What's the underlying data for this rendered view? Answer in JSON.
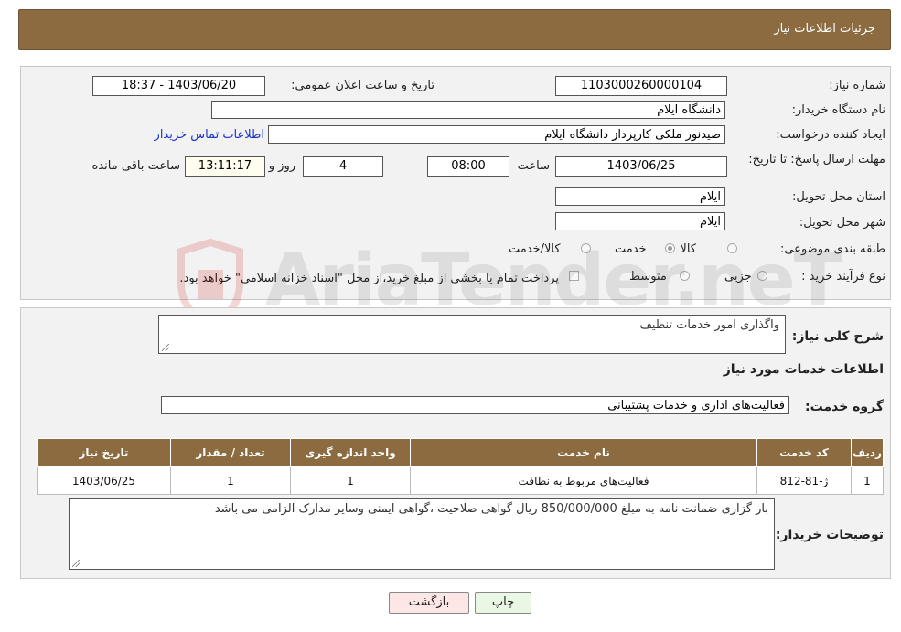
{
  "header": {
    "title": "جزئیات اطلاعات نیاز"
  },
  "form": {
    "need_number_label": "شماره نیاز:",
    "need_number": "1103000260000104",
    "announce_label": "تاریخ و ساعت اعلان عمومی:",
    "announce_value": "1403/06/20 - 18:37",
    "buyer_org_label": "نام دستگاه خریدار:",
    "buyer_org": "دانشگاه ایلام",
    "creator_label": "ایجاد کننده درخواست:",
    "creator": "صیدنور ملکی کارپرداز دانشگاه ایلام",
    "contact_link": "اطلاعات تماس خریدار",
    "deadline_label": "مهلت ارسال پاسخ: تا تاریخ:",
    "deadline_date": "1403/06/25",
    "time_label": "ساعت",
    "deadline_time": "08:00",
    "days_value": "4",
    "days_label": "روز و",
    "remaining_time": "13:11:17",
    "remaining_label": "ساعت باقی مانده",
    "province_label": "استان محل تحویل:",
    "province": "ایلام",
    "city_label": "شهر محل تحویل:",
    "city": "ایلام",
    "category_label": "طبقه بندی موضوعی:",
    "category_options": [
      "کالا",
      "خدمت",
      "کالا/خدمت"
    ],
    "category_selected": "خدمت",
    "process_label": "نوع فرآیند خرید :",
    "process_options": [
      "جزیی",
      "متوسط"
    ],
    "payment_note": "پرداخت تمام یا بخشی از مبلغ خرید،از محل \"اسناد خزانه اسلامی\" خواهد بود."
  },
  "need": {
    "summary_label": "شرح کلی نیاز:",
    "summary": "واگذاری امور خدمات تنظیف",
    "services_title": "اطلاعات خدمات مورد نیاز",
    "group_label": "گروه خدمت:",
    "group": "فعالیت‌های اداری و خدمات پشتیبانی"
  },
  "table": {
    "headers": [
      "ردیف",
      "کد خدمت",
      "نام خدمت",
      "واحد اندازه گیری",
      "تعداد / مقدار",
      "تاریخ نیاز"
    ],
    "rows": [
      [
        "1",
        "ژ-81-812",
        "فعالیت‌های مربوط به نظافت",
        "1",
        "1",
        "1403/06/25"
      ]
    ]
  },
  "buyer_notes": {
    "label": "توضیحات خریدار:",
    "text": "بار گزاری ضمانت نامه به مبلغ 850/000/000 ریال گواهی صلاحیت ،گواهی ایمنی وسایر مدارک الزامی می باشد"
  },
  "buttons": {
    "print": "چاپ",
    "back": "بازگشت"
  },
  "watermark": {
    "text": "AriaTender.neT"
  },
  "colors": {
    "header_bg": "#8b6b3f",
    "link": "#1a33cc",
    "back_button": "#fde6e6",
    "print_button": "#e9f7e4"
  }
}
